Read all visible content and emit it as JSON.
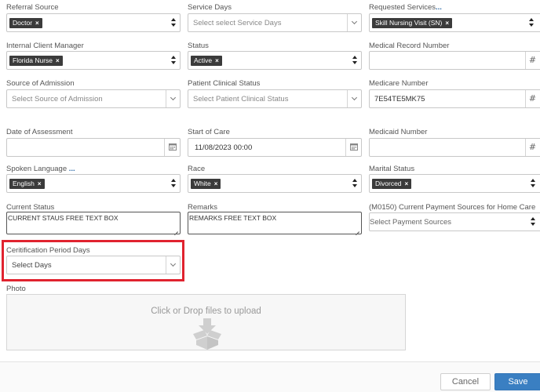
{
  "row1": {
    "referral_source": {
      "label": "Referral Source",
      "tag": "Doctor"
    },
    "service_days": {
      "label": "Service Days",
      "placeholder": "Select select Service Days"
    },
    "requested_services": {
      "label": "Requested Services",
      "label_suffix": "...",
      "tag": "Skill Nursing Visit (SN)"
    }
  },
  "row2": {
    "internal_client_manager": {
      "label": "Internal Client Manager",
      "tag": "Florida Nurse"
    },
    "status": {
      "label": "Status",
      "tag": "Active"
    },
    "medical_record_number": {
      "label": "Medical Record Number",
      "value": ""
    }
  },
  "row3": {
    "source_of_admission": {
      "label": "Source of Admission",
      "placeholder": "Select Source of Admission"
    },
    "patient_clinical_status": {
      "label": "Patient Clinical Status",
      "placeholder": "Select Patient Clinical Status"
    },
    "medicare_number": {
      "label": "Medicare Number",
      "value": "7E54TE5MK75"
    }
  },
  "row4": {
    "date_of_assessment": {
      "label": "Date of Assessment",
      "value": ""
    },
    "start_of_care": {
      "label": "Start of Care",
      "value": "11/08/2023 00:00"
    },
    "medicaid_number": {
      "label": "Medicaid Number",
      "value": ""
    }
  },
  "row5": {
    "spoken_language": {
      "label": "Spoken Language",
      "label_suffix": "...",
      "tag": "English"
    },
    "race": {
      "label": "Race",
      "tag": "White"
    },
    "marital_status": {
      "label": "Marital Status",
      "tag": "Divorced"
    }
  },
  "row6": {
    "current_status": {
      "label": "Current Status",
      "value": "CURRENT STAUS FREE TEXT BOX"
    },
    "remarks": {
      "label": "Remarks",
      "value": "REMARKS FREE TEXT BOX"
    },
    "payment_sources": {
      "label": "(M0150) Current Payment Sources for Home Care",
      "placeholder": "Select Payment Sources"
    }
  },
  "certification": {
    "label": "Ceritification Period Days",
    "placeholder": "Select Days"
  },
  "photo": {
    "label": "Photo",
    "drop_text": "Click or Drop files to upload"
  },
  "footer": {
    "cancel_label": "Cancel",
    "save_label": "Save"
  },
  "colors": {
    "highlight": "#e0232f",
    "primary": "#3a7fc2",
    "tag_bg": "#3b3b3b"
  }
}
